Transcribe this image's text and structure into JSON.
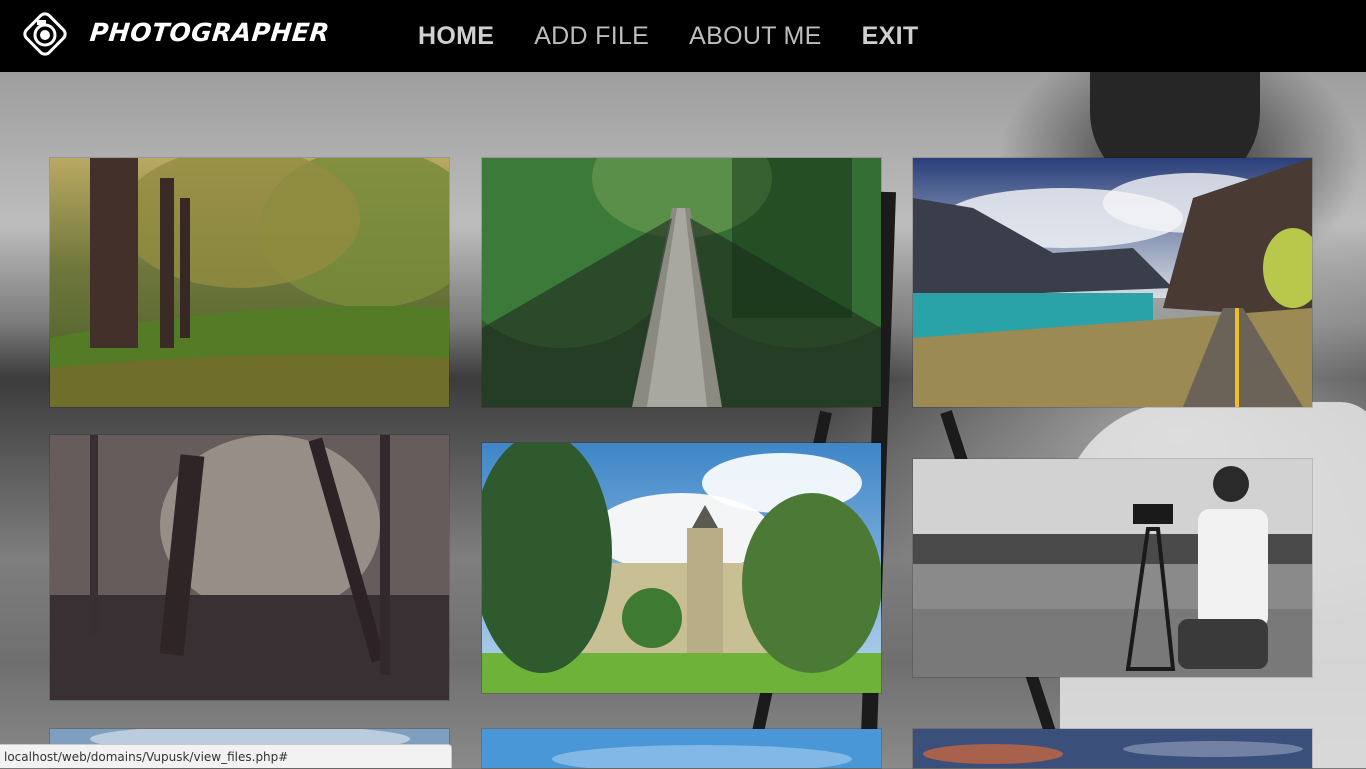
{
  "brand": {
    "name": "PHOTOGRAPHER",
    "logo_icon": "camera-aperture-icon"
  },
  "nav": {
    "items": [
      {
        "label": "HOME",
        "bold": true
      },
      {
        "label": "ADD FILE",
        "bold": false
      },
      {
        "label": "ABOUT ME",
        "bold": false
      },
      {
        "label": "EXIT",
        "bold": true
      }
    ]
  },
  "gallery": {
    "photos": [
      {
        "subject": "autumn-park"
      },
      {
        "subject": "forest-suspension-bridge"
      },
      {
        "subject": "mountain-lake-road"
      },
      {
        "subject": "misty-forest"
      },
      {
        "subject": "castle-tower-park"
      },
      {
        "subject": "videographer-by-water"
      },
      {
        "subject": "blue-sky"
      },
      {
        "subject": "blue-sky-2"
      },
      {
        "subject": "sunset-sky"
      }
    ]
  },
  "status_bar": {
    "url": "localhost/web/domains/Vupusk/view_files.php#"
  }
}
